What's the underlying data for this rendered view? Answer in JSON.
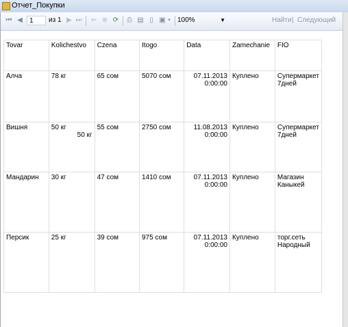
{
  "window": {
    "title": "Отчет_Покупки"
  },
  "toolbar": {
    "page_current": "1",
    "page_of": "из 1",
    "zoom": "100%",
    "find": "Найти",
    "find_separator": "|",
    "next": "Следующий"
  },
  "report": {
    "columns": [
      "Tovar",
      "Kolichestvo",
      "Czena",
      "Itogo",
      "Data",
      "Zamechanie",
      "FIO"
    ],
    "rows": [
      {
        "tovar": "Алча",
        "qty": "78 кг",
        "qty2": "",
        "price": "65 сом",
        "total": "5070 сом",
        "date": "07.11.2013",
        "time": "0:00:00",
        "note": "Куплено",
        "fio": "Супермаркет 7дней"
      },
      {
        "tovar": "Вишня",
        "qty": "50  кг",
        "qty2": "50 кг",
        "price": "55 сом",
        "total": "2750 сом",
        "date": "11.08.2013",
        "time": "0:00:00",
        "note": "Куплено",
        "fio": "Супермаркет 7дней"
      },
      {
        "tovar": "Мандарин",
        "qty": "30 кг",
        "qty2": "",
        "price": "47 сом",
        "total": "1410 сом",
        "date": "07.11.2013",
        "time": "0:00:00",
        "note": "Куплено",
        "fio": "Магазин Каныкей"
      },
      {
        "tovar": "Персик",
        "qty": "25 кг",
        "qty2": "",
        "price": "39 сом",
        "total": "975 сом",
        "date": "07.11.2013",
        "time": "0:00:00",
        "note": "Куплено",
        "fio": "торг.сеть Народный"
      }
    ]
  },
  "icons": [
    "first-page-icon",
    "prev-page-icon",
    "next-page-icon",
    "last-page-icon",
    "back-icon",
    "stop-icon",
    "refresh-icon",
    "print-icon",
    "print-layout-icon",
    "page-setup-icon",
    "export-icon"
  ]
}
